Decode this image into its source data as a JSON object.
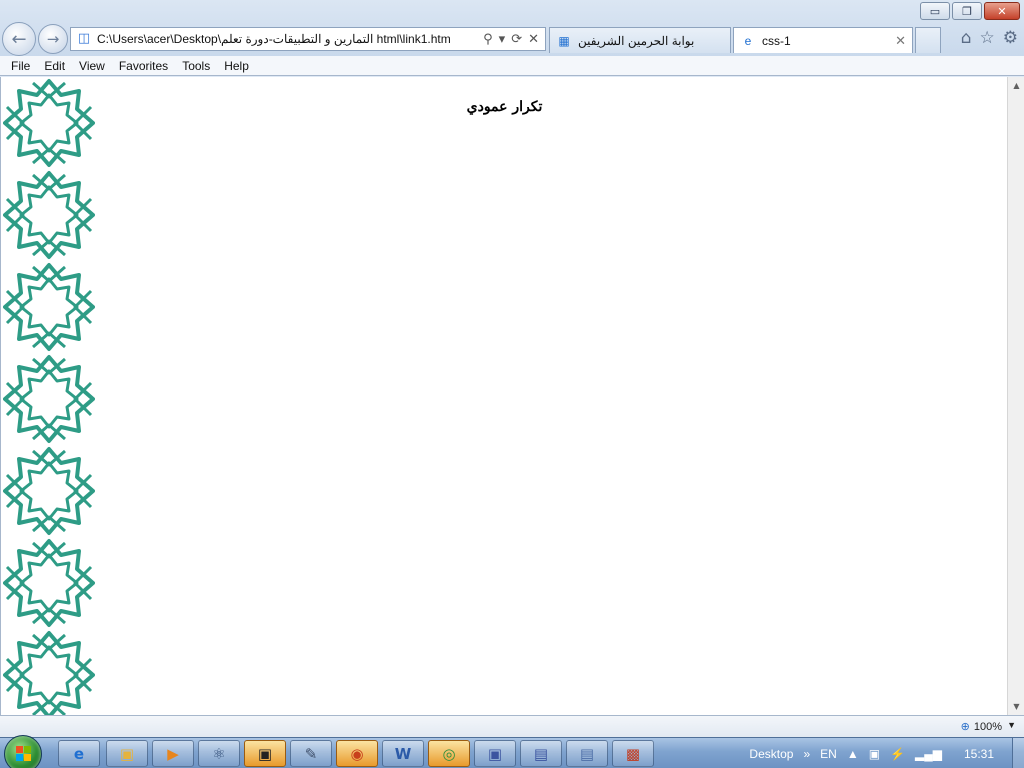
{
  "window": {
    "controls": {
      "minimize": "▭",
      "restore": "❐",
      "close": "✕"
    }
  },
  "nav": {
    "back_icon": "back-arrow-icon",
    "forward_icon": "forward-arrow-icon",
    "address": "C:\\Users\\acer\\Desktop\\التمارين و التطبيقات-دورة تعلم  html\\link1.htm"
  },
  "tabs": [
    {
      "label": "بوابة الحرمين الشريفين",
      "active": false
    },
    {
      "label": "css-1",
      "active": true
    }
  ],
  "menu": [
    "File",
    "Edit",
    "View",
    "Favorites",
    "Tools",
    "Help"
  ],
  "page": {
    "heading": "تكرار عمودي",
    "pattern_color": "#2e9c86",
    "pattern_repeats": 7
  },
  "status": {
    "zoom": "100%"
  },
  "taskbar": {
    "desktop_label": "Desktop",
    "language": "EN",
    "time": "15:31"
  }
}
